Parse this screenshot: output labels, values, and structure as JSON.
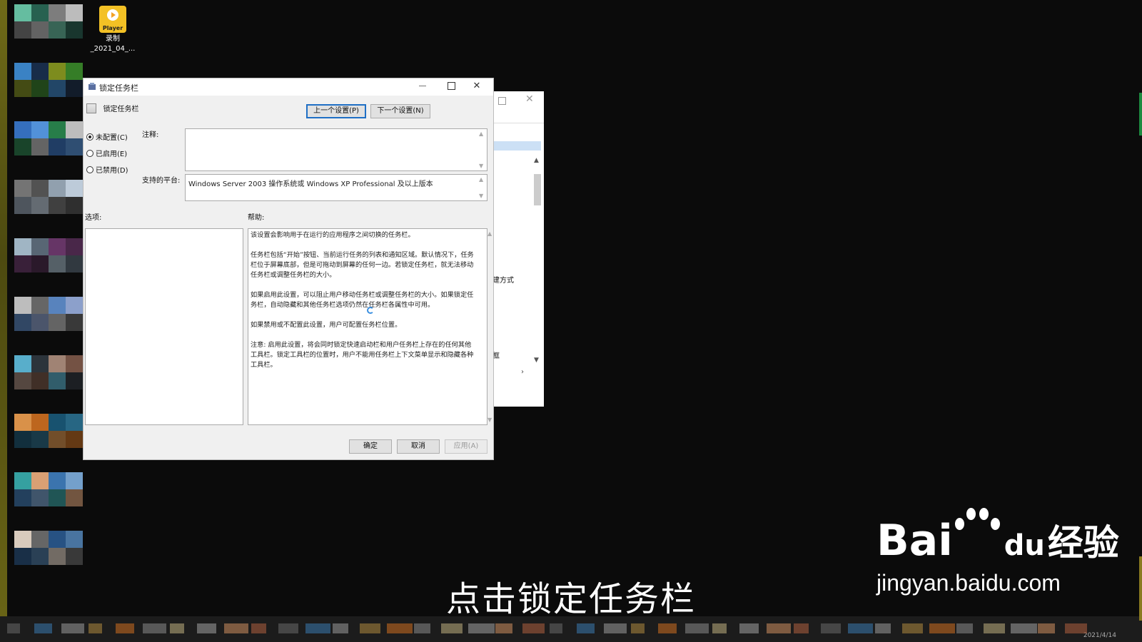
{
  "desktop": {
    "icon_label_top": "Player",
    "icon_name_line1": "录制",
    "icon_name_line2": "_2021_04_..."
  },
  "background_window": {
    "partial_text_1": "建方式",
    "partial_text_2": "框"
  },
  "dialog": {
    "title": "锁定任务栏",
    "setting_name": "锁定任务栏",
    "prev_button": "上一个设置(P)",
    "next_button": "下一个设置(N)",
    "radios": [
      {
        "label": "未配置(C)",
        "checked": true
      },
      {
        "label": "已启用(E)",
        "checked": false
      },
      {
        "label": "已禁用(D)",
        "checked": false
      }
    ],
    "comment_label": "注释:",
    "comment_value": "",
    "platform_label": "支持的平台:",
    "platform_value": "Windows Server 2003 操作系统或 Windows XP Professional 及以上版本",
    "options_label": "选项:",
    "help_label": "帮助:",
    "help_paragraphs": [
      "该设置会影响用于在运行的应用程序之间切换的任务栏。",
      "任务栏包括“开始”按钮、当前运行任务的列表和通知区域。默认情况下，任务栏位于屏幕底部，但是可拖动到屏幕的任何一边。若锁定任务栏，就无法移动任务栏或调整任务栏的大小。",
      "如果启用此设置，可以阻止用户移动任务栏或调整任务栏的大小。如果锁定任务栏，自动隐藏和其他任务栏选项仍然在任务栏各属性中可用。",
      "如果禁用或不配置此设置，用户可配置任务栏位置。",
      "注意: 启用此设置，将会同时锁定快速启动栏和用户任务栏上存在的任何其他工具栏。锁定工具栏的位置时，用户不能用任务栏上下文菜单显示和隐藏各种工具栏。"
    ],
    "ok_button": "确定",
    "cancel_button": "取消",
    "apply_button": "应用(A)"
  },
  "caption": "点击锁定任务栏",
  "watermark": {
    "logo_text_left": "Bai",
    "logo_text_du": "du",
    "logo_text_cn": "经验",
    "url": "jingyan.baidu.com"
  },
  "taskbar": {
    "date": "2021/4/14"
  },
  "colors": {
    "accent": "#1f6fc5",
    "desktop_bg": "#0b0b0b",
    "icon_yellow": "#f3c125"
  }
}
